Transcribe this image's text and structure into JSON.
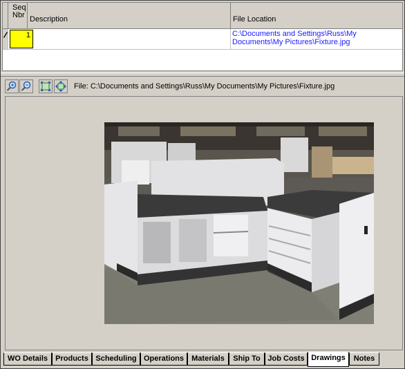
{
  "grid": {
    "columns": {
      "seq": "Seq\nNbr",
      "description": "Description",
      "file_location": "File Location"
    },
    "rows": [
      {
        "seq": "1",
        "description": "",
        "file_location": "C:\\Documents and Settings\\Russ\\My Documents\\My Pictures\\Fixture.jpg"
      }
    ]
  },
  "toolbar": {
    "file_label": "File:  C:\\Documents and Settings\\Russ\\My Documents\\My Pictures\\Fixture.jpg",
    "buttons": [
      "zoom-in-icon",
      "zoom-out-icon",
      "fit-icon",
      "actual-size-icon"
    ]
  },
  "tabs": [
    {
      "label": "WO Details",
      "active": false
    },
    {
      "label": "Products",
      "active": false
    },
    {
      "label": "Scheduling",
      "active": false
    },
    {
      "label": "Operations",
      "active": false
    },
    {
      "label": "Materials",
      "active": false
    },
    {
      "label": "Ship To",
      "active": false
    },
    {
      "label": "Job Costs",
      "active": false
    },
    {
      "label": "Drawings",
      "active": true
    },
    {
      "label": "Notes",
      "active": false
    }
  ],
  "colors": {
    "selected_cell": "#ffff00",
    "link": "#1a1aff",
    "chrome": "#d4d0c8"
  }
}
